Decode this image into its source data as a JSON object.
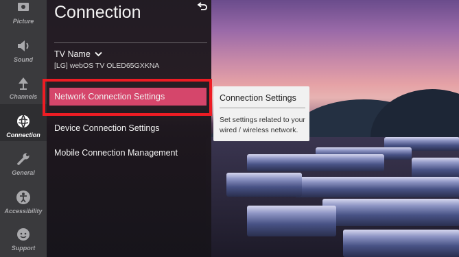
{
  "sidebar": {
    "items": [
      {
        "label": "Picture",
        "icon": "picture-icon",
        "active": false
      },
      {
        "label": "Sound",
        "icon": "speaker-icon",
        "active": false
      },
      {
        "label": "Channels",
        "icon": "antenna-icon",
        "active": false
      },
      {
        "label": "Connection",
        "icon": "globe-icon",
        "active": true
      },
      {
        "label": "General",
        "icon": "wrench-icon",
        "active": false
      },
      {
        "label": "Accessibility",
        "icon": "accessibility-icon",
        "active": false
      },
      {
        "label": "Support",
        "icon": "support-icon",
        "active": false
      }
    ]
  },
  "panel": {
    "title": "Connection",
    "tv_name_label": "TV Name",
    "tv_name_value": "[LG] webOS TV OLED65GXKNA",
    "menu": [
      {
        "label": "Network Connection Settings",
        "selected": true
      },
      {
        "label": "Device Connection Settings",
        "selected": false
      },
      {
        "label": "Mobile Connection Management",
        "selected": false
      }
    ]
  },
  "tooltip": {
    "title": "Connection Settings",
    "description": "Set settings related to your wired / wireless network."
  },
  "colors": {
    "selected_bg": "#d5466b",
    "highlight_border": "#ee1c24",
    "rail_bg": "#3a3a3d"
  }
}
